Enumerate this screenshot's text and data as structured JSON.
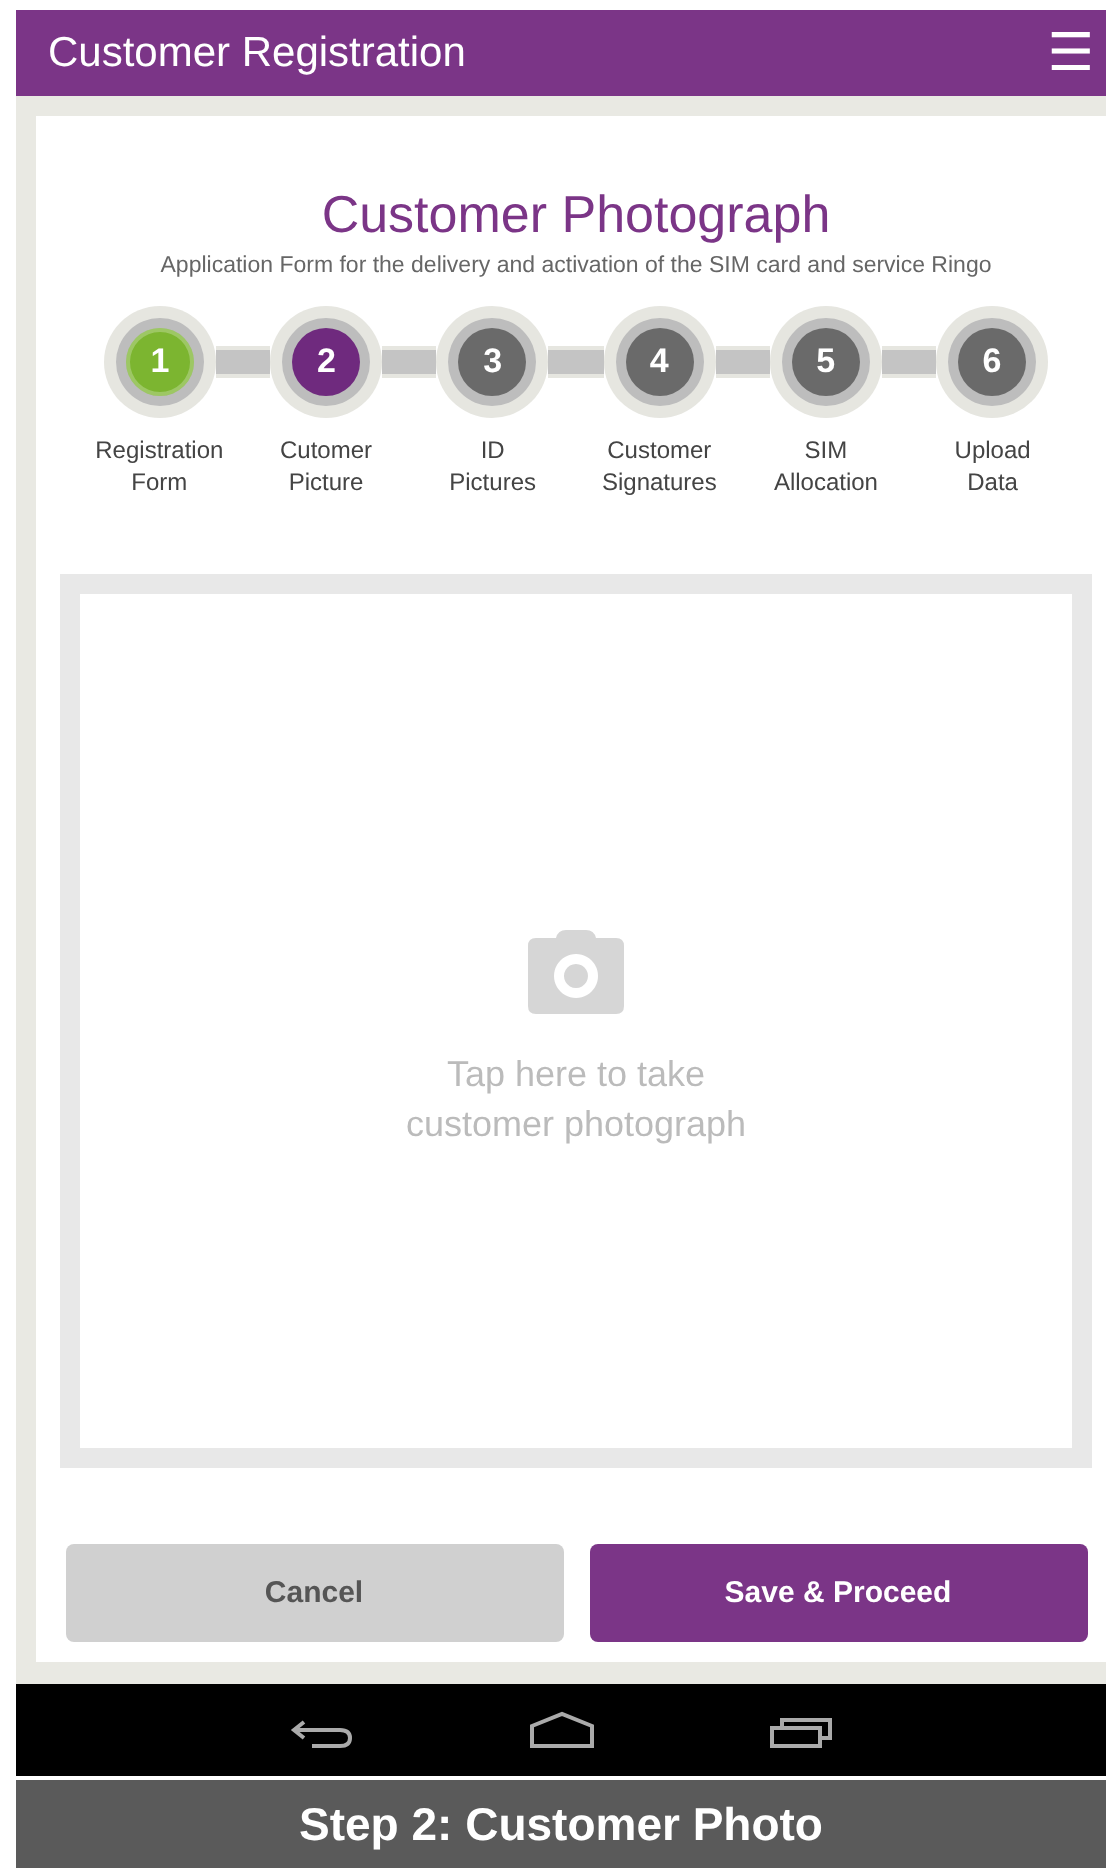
{
  "app_bar": {
    "title": "Customer Registration",
    "menu_icon": "☰"
  },
  "page": {
    "title": "Customer Photograph",
    "subtitle": "Application Form for the delivery and activation of the SIM card and service Ringo"
  },
  "steps": [
    {
      "number": "1",
      "label": "Registration Form",
      "completed": true,
      "selected": false
    },
    {
      "number": "2",
      "label": "Cutomer Picture",
      "completed": false,
      "selected": true
    },
    {
      "number": "3",
      "label": "ID Pictures",
      "completed": false,
      "selected": false
    },
    {
      "number": "4",
      "label": "Customer Signatures",
      "completed": false,
      "selected": false
    },
    {
      "number": "5",
      "label": "SIM Allocation",
      "completed": false,
      "selected": false
    },
    {
      "number": "6",
      "label": "Upload Data",
      "completed": false,
      "selected": false
    }
  ],
  "photo_area": {
    "prompt": "Tap here to take customer photograph"
  },
  "buttons": [
    {
      "label": "Cancel",
      "kind": "secondary"
    },
    {
      "label": "Save & Proceed",
      "kind": "primary"
    }
  ],
  "caption": "Step 2: Customer Photo"
}
